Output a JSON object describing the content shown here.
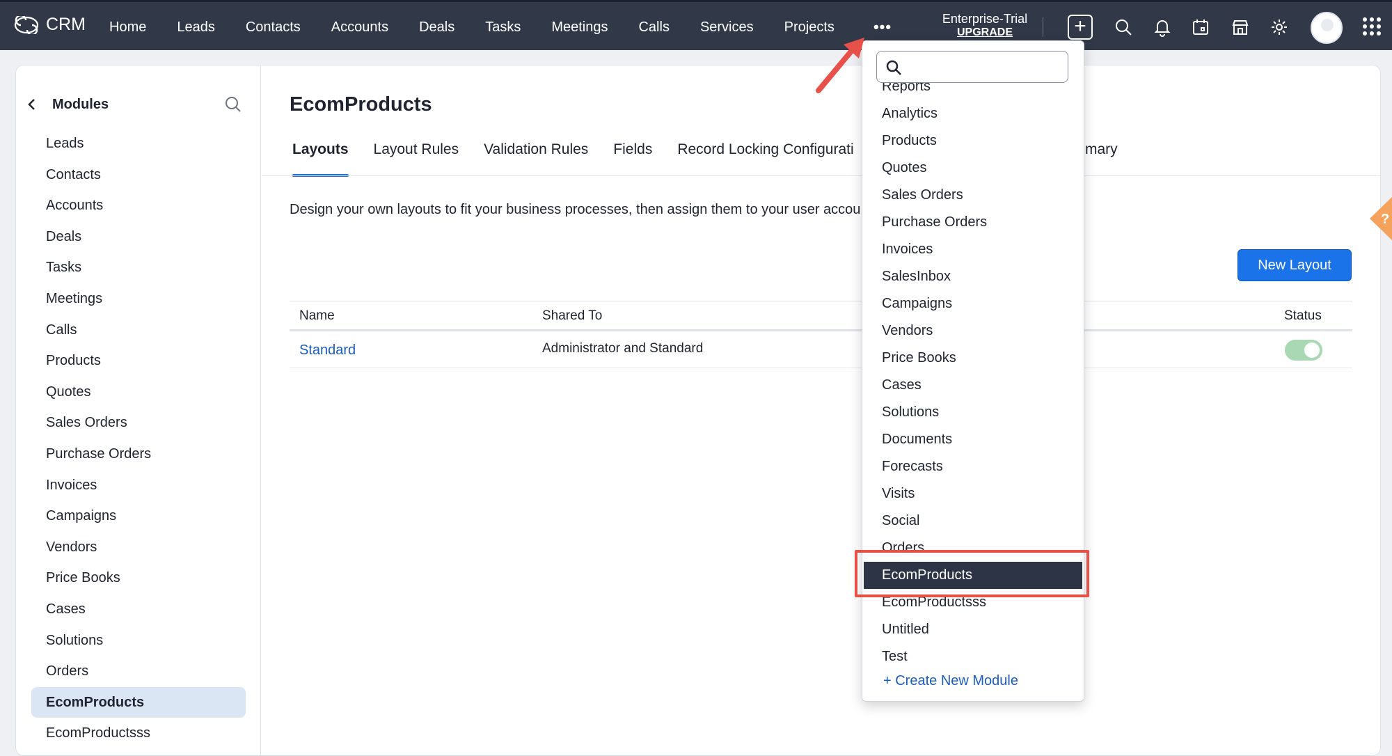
{
  "topbar": {
    "app_name": "CRM",
    "nav": [
      "Home",
      "Leads",
      "Contacts",
      "Accounts",
      "Deals",
      "Tasks",
      "Meetings",
      "Calls",
      "Services",
      "Projects"
    ],
    "more_label": "•••",
    "plan": "Enterprise-Trial",
    "upgrade": "UPGRADE",
    "create_label": "+"
  },
  "sidebar": {
    "title": "Modules",
    "items": [
      "Leads",
      "Contacts",
      "Accounts",
      "Deals",
      "Tasks",
      "Meetings",
      "Calls",
      "Products",
      "Quotes",
      "Sales Orders",
      "Purchase Orders",
      "Invoices",
      "Campaigns",
      "Vendors",
      "Price Books",
      "Cases",
      "Solutions",
      "Orders",
      "EcomProducts",
      "EcomProductsss"
    ],
    "active": "EcomProducts"
  },
  "main": {
    "title": "EcomProducts",
    "tabs": [
      "Layouts",
      "Layout Rules",
      "Validation Rules",
      "Fields",
      "Record Locking Configurati"
    ],
    "tab_summary_partial": "mary",
    "description": "Design your own layouts to fit your business processes, then assign them to your user accou",
    "new_layout_button": "New Layout",
    "table": {
      "columns": [
        "Name",
        "Shared To",
        "Status"
      ],
      "rows": [
        {
          "name": "Standard",
          "shared_to": "Administrator and Standard",
          "status": "on"
        }
      ]
    },
    "help_icon": "?"
  },
  "dropdown": {
    "search_placeholder": "",
    "items": [
      "Reports",
      "Analytics",
      "Products",
      "Quotes",
      "Sales Orders",
      "Purchase Orders",
      "Invoices",
      "SalesInbox",
      "Campaigns",
      "Vendors",
      "Price Books",
      "Cases",
      "Solutions",
      "Documents",
      "Forecasts",
      "Visits",
      "Social",
      "Orders",
      "EcomProducts",
      "EcomProductsss",
      "Untitled",
      "Test"
    ],
    "selected": "EcomProducts",
    "create_label": "+ Create New Module"
  },
  "colors": {
    "topbar": "#313949",
    "accent": "#1a73e8",
    "highlight": "#e8504a",
    "selected_item": "#2d3445",
    "help_tab": "#f5a25d"
  }
}
